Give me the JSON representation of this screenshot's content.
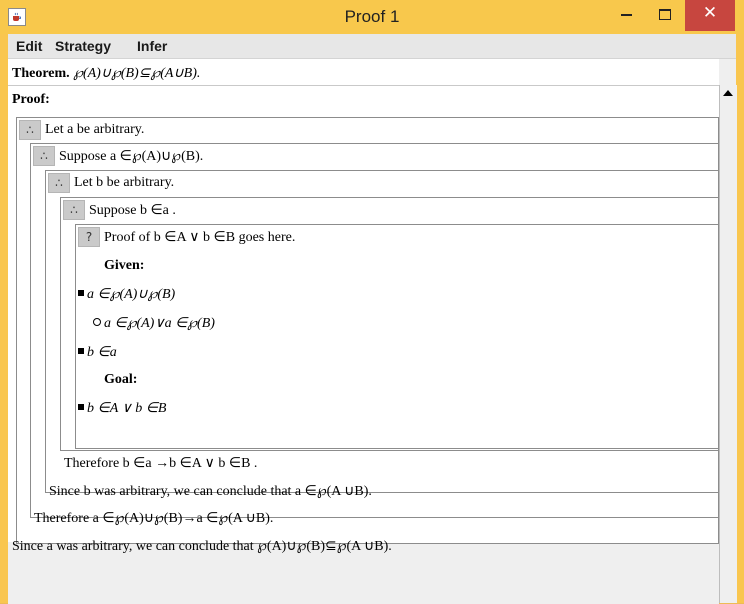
{
  "window": {
    "title": "Proof 1",
    "controls": {
      "minimize": "–",
      "maximize": "□",
      "close": "✕"
    }
  },
  "menu": [
    "Edit",
    "Strategy",
    "Infer"
  ],
  "proof": {
    "theorem_label": "Theorem.",
    "theorem_text": "℘(A)∪℘(B)⊆℘(A∪B).",
    "proof_label": "Proof:",
    "therefore_symbol": "∴",
    "question_symbol": "?",
    "steps": {
      "let_a": "Let a be arbitrary.",
      "suppose_a": "Suppose a ∈℘(A)∪℘(B).",
      "let_b": "Let b be arbitrary.",
      "suppose_b": "Suppose b ∈a .",
      "goal_stub": "Proof of b ∈A ∨ b ∈B goes here.",
      "given_label": "Given:",
      "given_1": "a ∈℘(A)∪℘(B)",
      "given_1_sub": "a ∈℘(A)∨a ∈℘(B)",
      "given_2": "b ∈a",
      "goal_label": "Goal:",
      "goal_1": "b ∈A ∨ b ∈B",
      "therefore_b": "Therefore b ∈a →b ∈A ∨ b ∈B .",
      "since_b": "Since b was arbitrary, we can conclude that a ∈℘(A ∪B).",
      "therefore_a": "Therefore a ∈℘(A)∪℘(B)→a ∈℘(A ∪B).",
      "since_a": "Since a was arbitrary, we can conclude that ℘(A)∪℘(B)⊆℘(A ∪B)."
    }
  }
}
